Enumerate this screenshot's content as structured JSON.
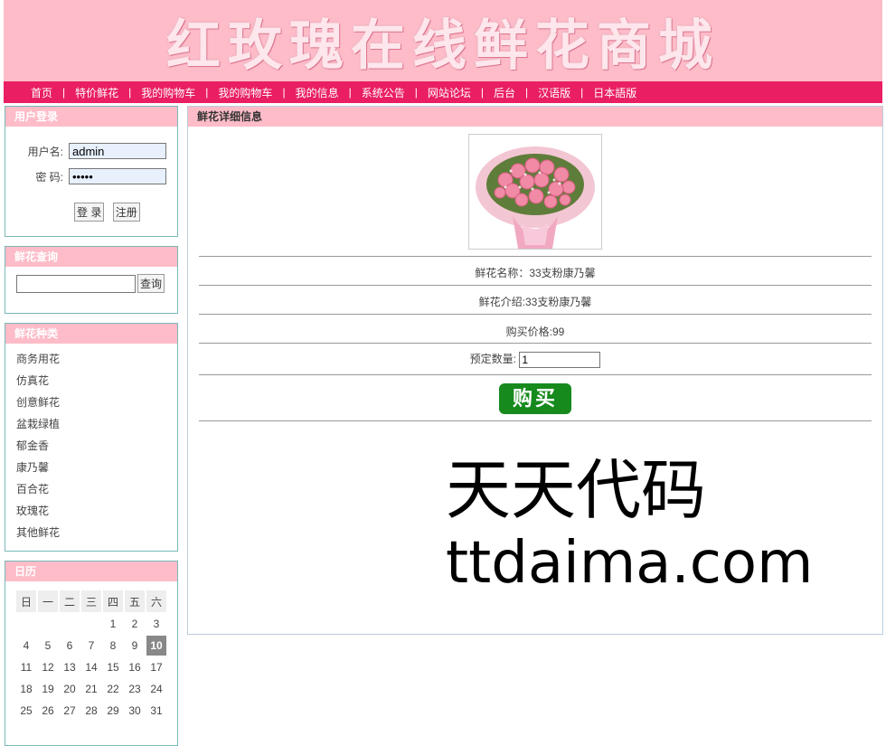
{
  "banner": {
    "title": "红玫瑰在线鲜花商城"
  },
  "nav": {
    "items": [
      "首页",
      "特价鲜花",
      "我的购物车",
      "我的购物车",
      "我的信息",
      "系统公告",
      "网站论坛",
      "后台",
      "汉语版",
      "日本語版"
    ],
    "separator": "|"
  },
  "login": {
    "title": "用户登录",
    "username_label": "用户名:",
    "username_value": "admin",
    "password_label": "密 码:",
    "password_value": "•••••",
    "login_button": "登 录",
    "register_button": "注册"
  },
  "search": {
    "title": "鲜花查询",
    "value": "",
    "button": "查询"
  },
  "categories": {
    "title": "鲜花种类",
    "items": [
      "商务用花",
      "仿真花",
      "创意鲜花",
      "盆栽绿植",
      "郁金香",
      "康乃馨",
      "百合花",
      "玫瑰花",
      "其他鲜花"
    ]
  },
  "calendar": {
    "title": "日历",
    "weekdays": [
      "日",
      "一",
      "二",
      "三",
      "四",
      "五",
      "六"
    ],
    "weeks": [
      [
        "",
        "",
        "",
        "",
        "1",
        "2",
        "3"
      ],
      [
        "4",
        "5",
        "6",
        "7",
        "8",
        "9",
        "10"
      ],
      [
        "11",
        "12",
        "13",
        "14",
        "15",
        "16",
        "17"
      ],
      [
        "18",
        "19",
        "20",
        "21",
        "22",
        "23",
        "24"
      ],
      [
        "25",
        "26",
        "27",
        "28",
        "29",
        "30",
        "31"
      ]
    ],
    "today": "10"
  },
  "detail": {
    "title": "鲜花详细信息",
    "name": "鲜花名称：33支粉康乃馨",
    "intro": "鲜花介绍:33支粉康乃馨",
    "price": "购买价格:99",
    "qty_label": "预定数量:",
    "qty_value": "1",
    "buy_button": "购买"
  },
  "watermark": {
    "line1": "天天代码",
    "line2": "ttdaima.com"
  },
  "colors": {
    "pink": "#fdbcc8",
    "nav": "#e91e63",
    "buy": "#178a1e",
    "border": "#7ab8b8"
  }
}
